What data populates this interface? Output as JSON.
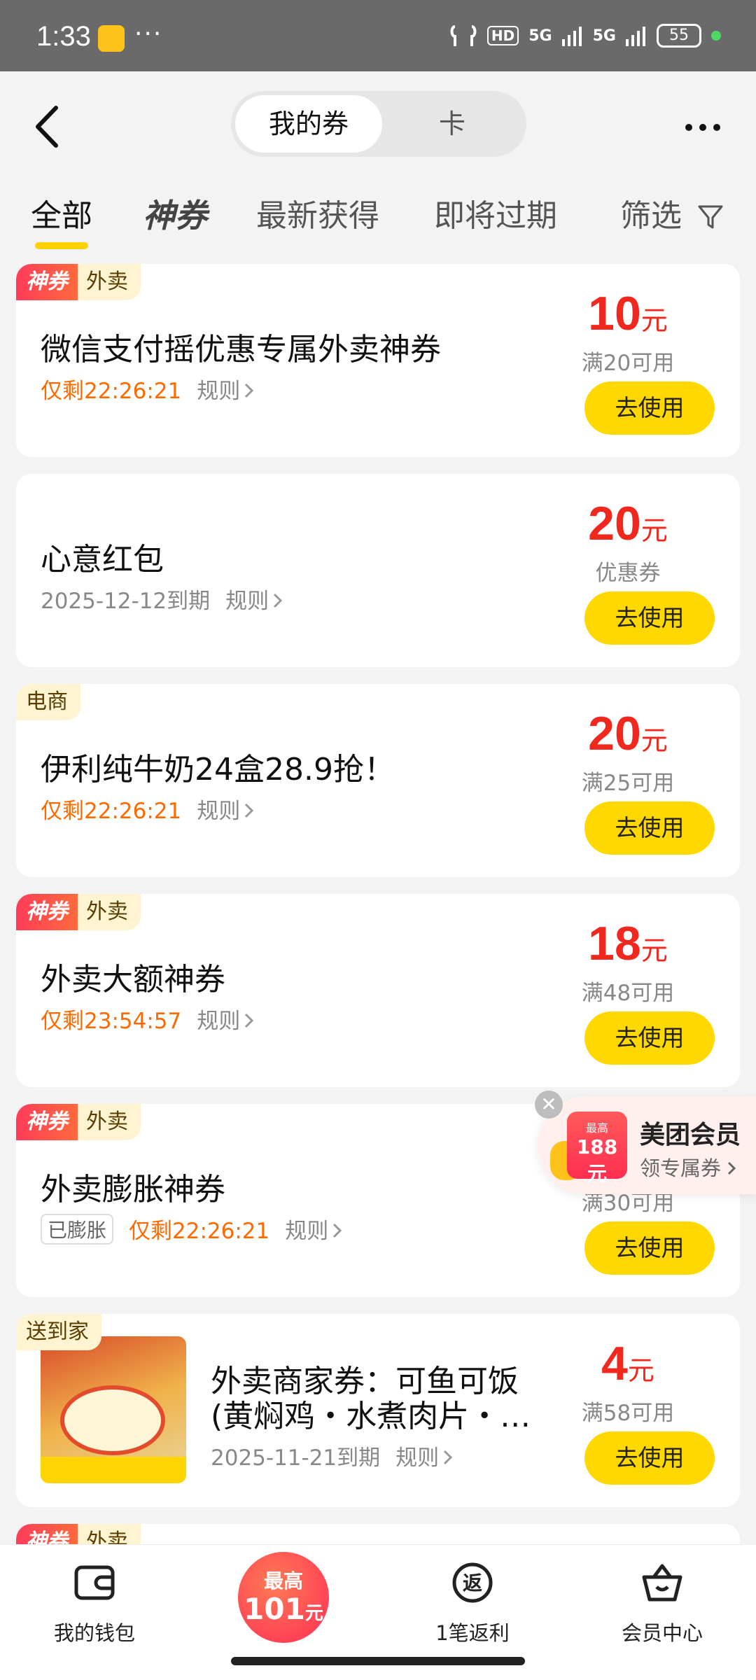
{
  "status_bar": {
    "time": "1:33",
    "dots": "···",
    "hd": "HD",
    "signal1": "5G",
    "signal2": "5G",
    "battery": "55"
  },
  "header": {
    "segments": [
      "我的券",
      "卡"
    ]
  },
  "tabs": [
    "全部",
    "神券",
    "最新获得",
    "即将过期",
    "筛选"
  ],
  "coupons": [
    {
      "tags": [
        "神券",
        "外卖"
      ],
      "title": "微信支付摇优惠专属外卖神券",
      "countdown": "仅剩22:26:21",
      "rule": "规则",
      "amount": "10",
      "unit": "元",
      "condition": "满20可用",
      "button": "去使用"
    },
    {
      "tags": [],
      "title": "心意红包",
      "expiry": "2025-12-12到期",
      "rule": "规则",
      "amount": "20",
      "unit": "元",
      "condition": "优惠券",
      "button": "去使用"
    },
    {
      "tags": [
        "电商"
      ],
      "title": "伊利纯牛奶24盒28.9抢！",
      "countdown": "仅剩22:26:21",
      "rule": "规则",
      "amount": "20",
      "unit": "元",
      "condition": "满25可用",
      "button": "去使用"
    },
    {
      "tags": [
        "神券",
        "外卖"
      ],
      "title": "外卖大额神券",
      "countdown": "仅剩23:54:57",
      "rule": "规则",
      "amount": "18",
      "unit": "元",
      "condition": "满48可用",
      "button": "去使用"
    },
    {
      "tags": [
        "神券",
        "外卖"
      ],
      "title": "外卖膨胀神券",
      "badge": "已膨胀",
      "countdown": "仅剩22:26:21",
      "rule": "规则",
      "condition": "满30可用",
      "button": "去使用"
    },
    {
      "tags": [
        "送到家"
      ],
      "title_line1": "外卖商家券：可鱼可饭",
      "title_line2": "(黄焖鸡・水煮肉片・…",
      "expiry": "2025-11-21到期",
      "rule": "规则",
      "amount": "4",
      "unit": "元",
      "condition": "满58可用",
      "button": "去使用"
    },
    {
      "tags": [
        "神券",
        "外卖"
      ]
    }
  ],
  "promo": {
    "close": "✕",
    "coupon_top": "最高",
    "coupon_value": "188元",
    "title": "美团会员",
    "subtitle": "领专属券"
  },
  "bottom_nav": {
    "wallet": "我的钱包",
    "center_top": "最高",
    "center_value": "101",
    "center_unit": "元",
    "rebate_icon": "返",
    "rebate": "1笔返利",
    "member": "会员中心"
  },
  "colors": {
    "accent_yellow": "#ffd800",
    "price_red": "#f0281e",
    "countdown_orange": "#ff6a00"
  }
}
